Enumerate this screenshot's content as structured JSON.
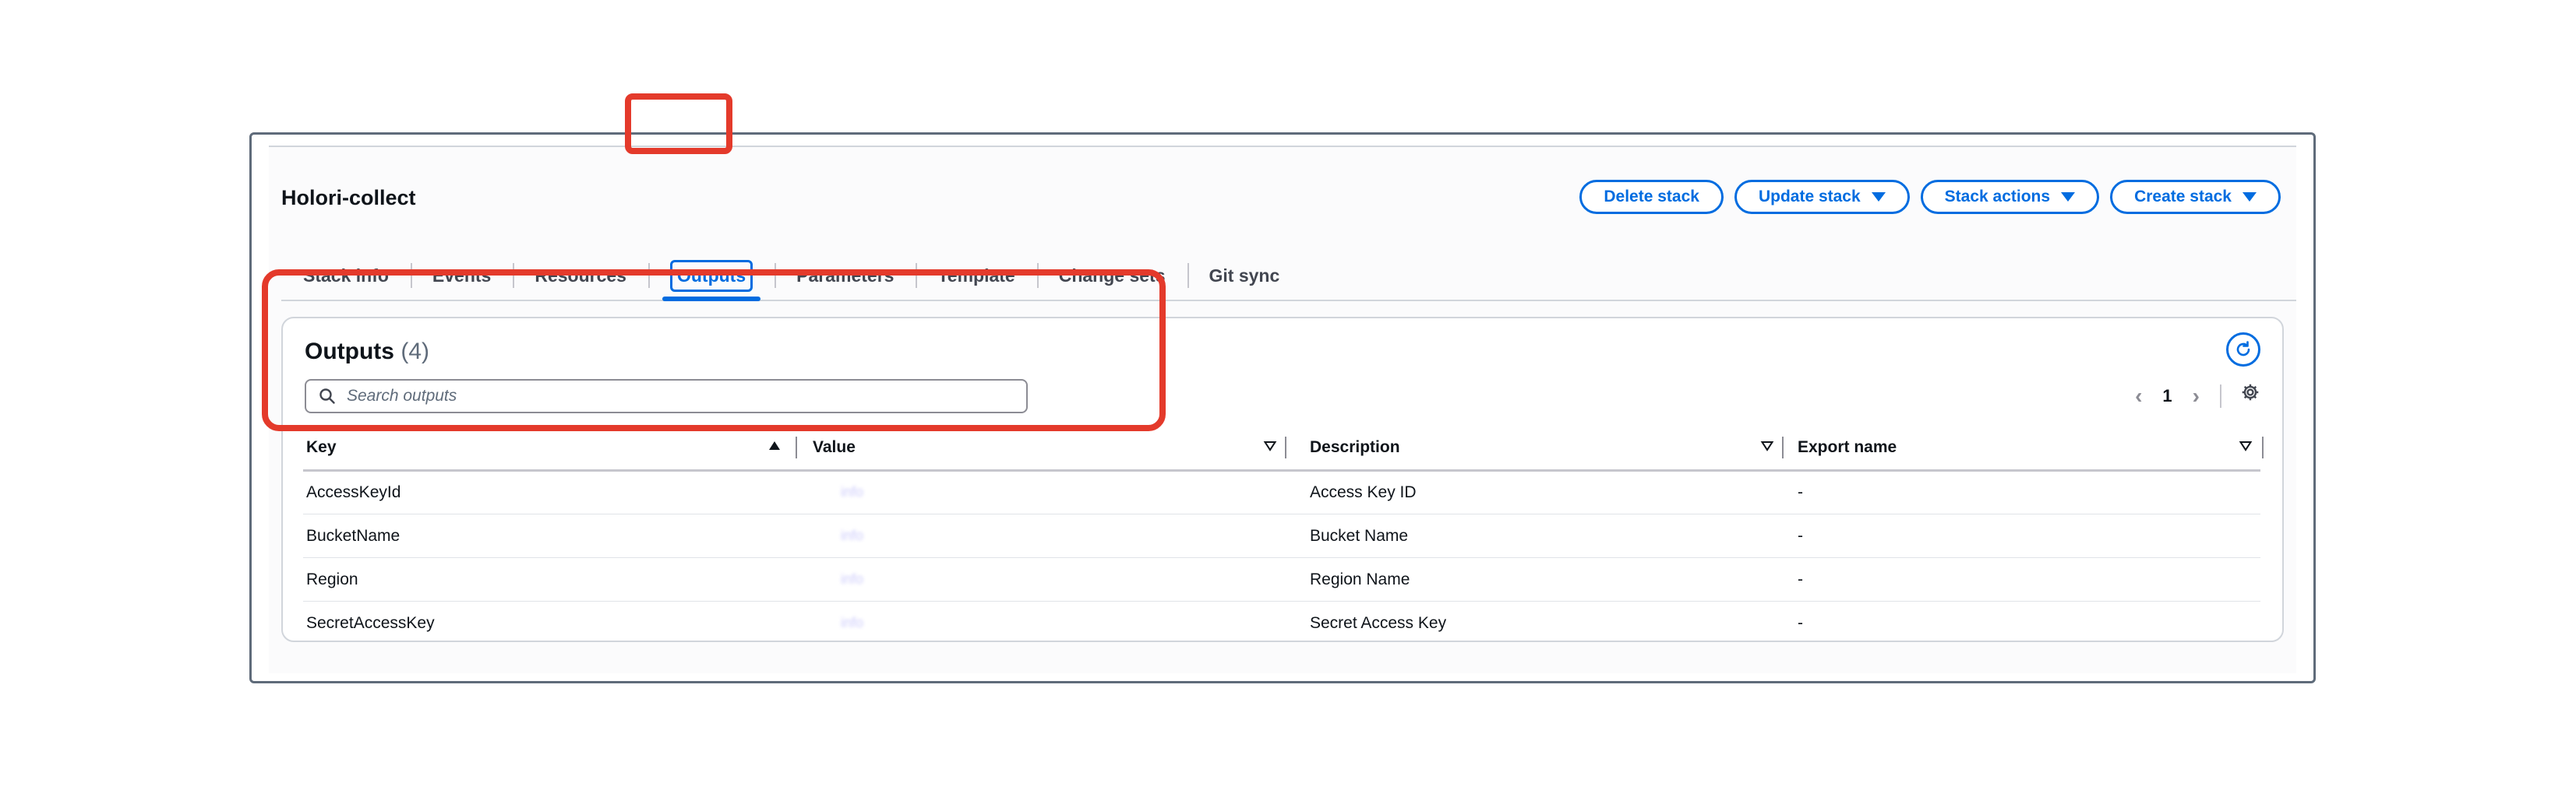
{
  "stack": {
    "name": "Holori-collect",
    "actions": [
      {
        "label": "Delete stack",
        "dropdown": false
      },
      {
        "label": "Update stack",
        "dropdown": true
      },
      {
        "label": "Stack actions",
        "dropdown": true
      },
      {
        "label": "Create stack",
        "dropdown": true
      }
    ]
  },
  "tabs": [
    "Stack info",
    "Events",
    "Resources",
    "Outputs",
    "Parameters",
    "Template",
    "Change sets",
    "Git sync"
  ],
  "active_tab": "Outputs",
  "outputs": {
    "title": "Outputs",
    "count": "(4)",
    "search_placeholder": "Search outputs",
    "page": "1",
    "columns": [
      "Key",
      "Value",
      "Description",
      "Export name"
    ],
    "rows": [
      {
        "key": "AccessKeyId",
        "value": "info",
        "description": "Access Key ID",
        "export": "-"
      },
      {
        "key": "BucketName",
        "value": "info",
        "description": "Bucket Name",
        "export": "-"
      },
      {
        "key": "Region",
        "value": "info",
        "description": "Region Name",
        "export": "-"
      },
      {
        "key": "SecretAccessKey",
        "value": "info",
        "description": "Secret Access Key",
        "export": "-"
      }
    ]
  },
  "colors": {
    "accent": "#006ce0",
    "highlight": "#e43a2b"
  },
  "icons": [
    "search-icon",
    "refresh-icon",
    "chevron-left-icon",
    "chevron-right-icon",
    "gear-icon",
    "caret-down-icon",
    "sort-ascending-icon",
    "sort-icon"
  ]
}
